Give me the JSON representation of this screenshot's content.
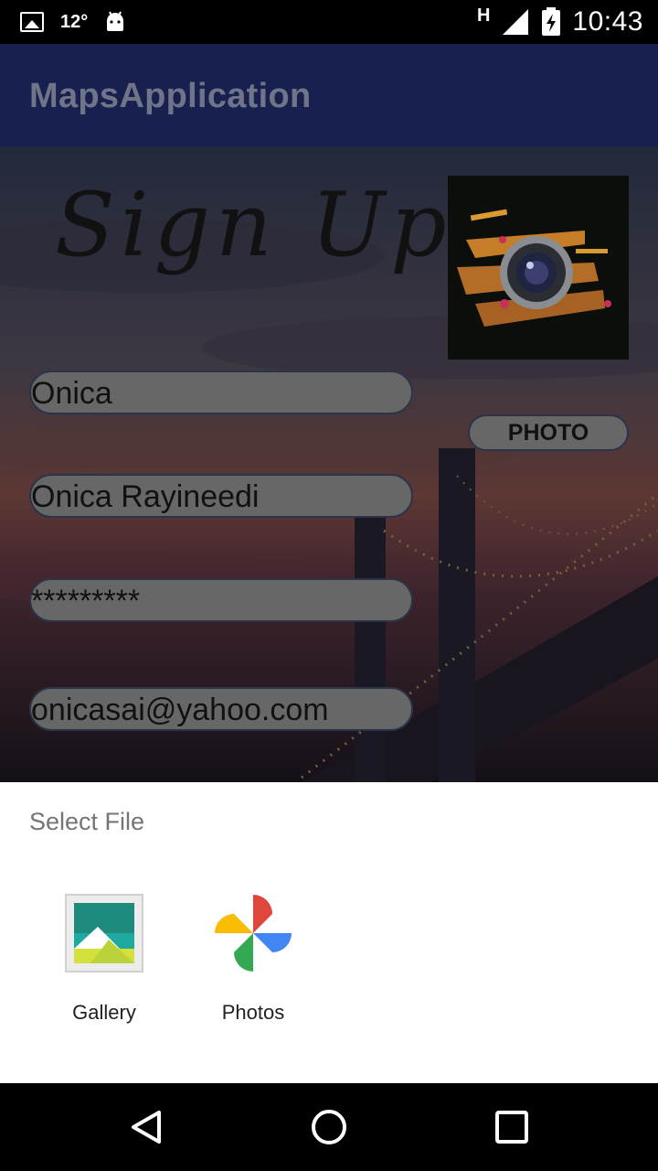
{
  "status_bar": {
    "temperature": "12°",
    "network": "H",
    "time": "10:43"
  },
  "app_bar": {
    "title": "MapsApplication"
  },
  "form": {
    "title": "Sign Up",
    "name_field": "Onica",
    "fullname_field": "Onica Rayineedi",
    "password_field": "*********",
    "email_field": "onicasai@yahoo.com",
    "photo_button": "PHOTO"
  },
  "sheet": {
    "title": "Select File",
    "options": [
      {
        "label": "Gallery",
        "icon": "gallery-icon"
      },
      {
        "label": "Photos",
        "icon": "photos-icon"
      }
    ]
  },
  "nav": {
    "icons": [
      "back-icon",
      "home-icon",
      "recents-icon"
    ]
  },
  "colors": {
    "app_bar": "#18204f",
    "field_bg": "#676767"
  }
}
